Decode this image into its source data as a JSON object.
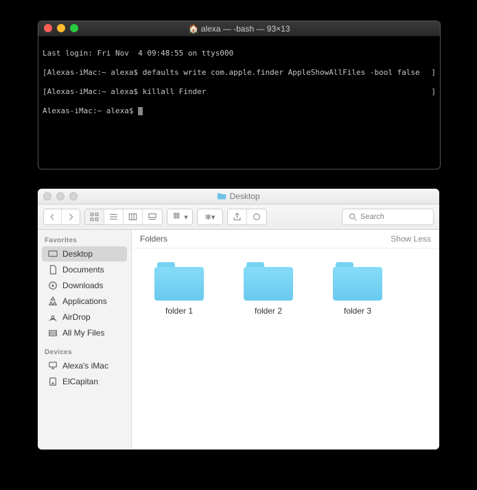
{
  "terminal": {
    "title": "alexa — -bash — 93×13",
    "line1": "Last login: Fri Nov  4 09:48:55 on ttys000",
    "line2_prompt": "Alexas-iMac:~ alexa$ ",
    "line2_cmd": "defaults write com.apple.finder AppleShowAllFiles -bool false",
    "line3_prompt": "Alexas-iMac:~ alexa$ ",
    "line3_cmd": "killall Finder",
    "line4_prompt": "Alexas-iMac:~ alexa$ "
  },
  "finder": {
    "title": "Desktop",
    "search_placeholder": "Search",
    "section_label": "Folders",
    "show_less": "Show Less",
    "sidebar": {
      "favorites_header": "Favorites",
      "items_fav": [
        {
          "label": "Desktop"
        },
        {
          "label": "Documents"
        },
        {
          "label": "Downloads"
        },
        {
          "label": "Applications"
        },
        {
          "label": "AirDrop"
        },
        {
          "label": "All My Files"
        }
      ],
      "devices_header": "Devices",
      "items_dev": [
        {
          "label": "Alexa's iMac"
        },
        {
          "label": "ElCapitan"
        }
      ]
    },
    "folders": [
      {
        "label": "folder 1"
      },
      {
        "label": "folder 2"
      },
      {
        "label": "folder 3"
      }
    ]
  }
}
